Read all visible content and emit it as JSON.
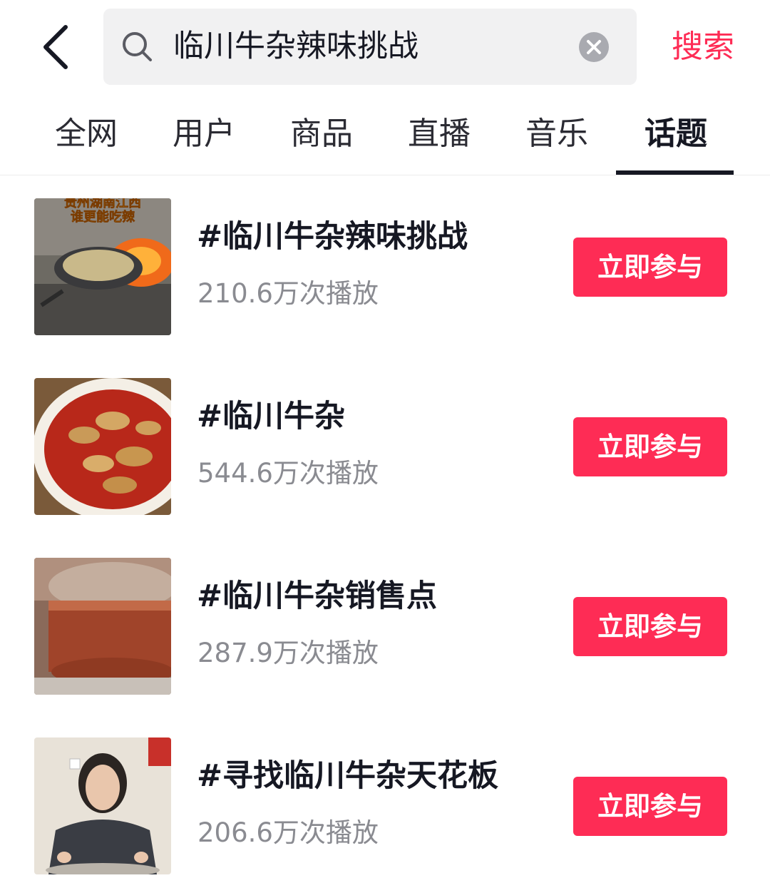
{
  "header": {
    "back_icon": "chevron-left-icon",
    "search_query": "临川牛杂辣味挑战",
    "search_icon": "search-icon",
    "clear_icon": "clear-circle-icon",
    "search_button_label": "搜索"
  },
  "tabs": [
    {
      "label": "全网",
      "active": false
    },
    {
      "label": "用户",
      "active": false
    },
    {
      "label": "商品",
      "active": false
    },
    {
      "label": "直播",
      "active": false
    },
    {
      "label": "音乐",
      "active": false
    },
    {
      "label": "话题",
      "active": true
    }
  ],
  "topics": [
    {
      "title": "#临川牛杂辣味挑战",
      "plays": "210.6万次播放",
      "button": "立即参与",
      "thumb_caption": [
        "贵州湖南江西",
        "谁更能吃辣"
      ]
    },
    {
      "title": "#临川牛杂",
      "plays": "544.6万次播放",
      "button": "立即参与"
    },
    {
      "title": "#临川牛杂销售点",
      "plays": "287.9万次播放",
      "button": "立即参与"
    },
    {
      "title": "#寻找临川牛杂天花板",
      "plays": "206.6万次播放",
      "button": "立即参与"
    }
  ],
  "colors": {
    "accent": "#fe2c55",
    "text_primary": "#161823",
    "text_secondary": "#8a8b91",
    "search_bg": "#f1f1f2"
  }
}
